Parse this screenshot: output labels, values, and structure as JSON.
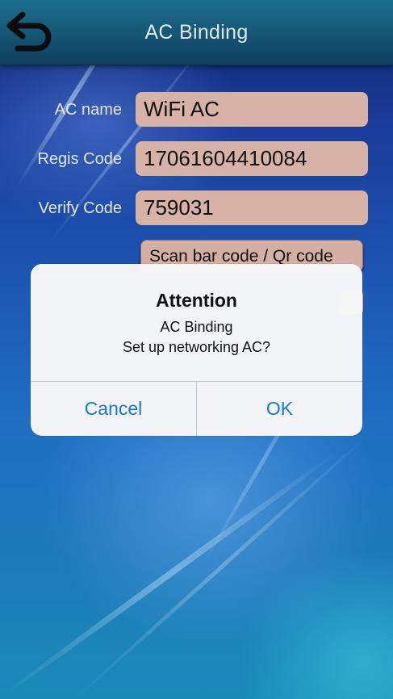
{
  "header": {
    "title": "AC Binding",
    "back_icon": "back-arrow-icon"
  },
  "form": {
    "ac_name_label": "AC name",
    "ac_name_value": "WiFi AC",
    "regis_code_label": "Regis Code",
    "regis_code_value": "17061604410084",
    "verify_code_label": "Verify Code",
    "verify_code_value": "759031",
    "scan_button_label": "Scan bar code / Qr code"
  },
  "dialog": {
    "title": "Attention",
    "message_line1": "AC Binding",
    "message_line2": "Set up networking AC?",
    "cancel_label": "Cancel",
    "ok_label": "OK"
  },
  "colors": {
    "header_bar": "#165a78",
    "field_background": "#d6b3a6",
    "dialog_button_text": "#1579d2"
  }
}
